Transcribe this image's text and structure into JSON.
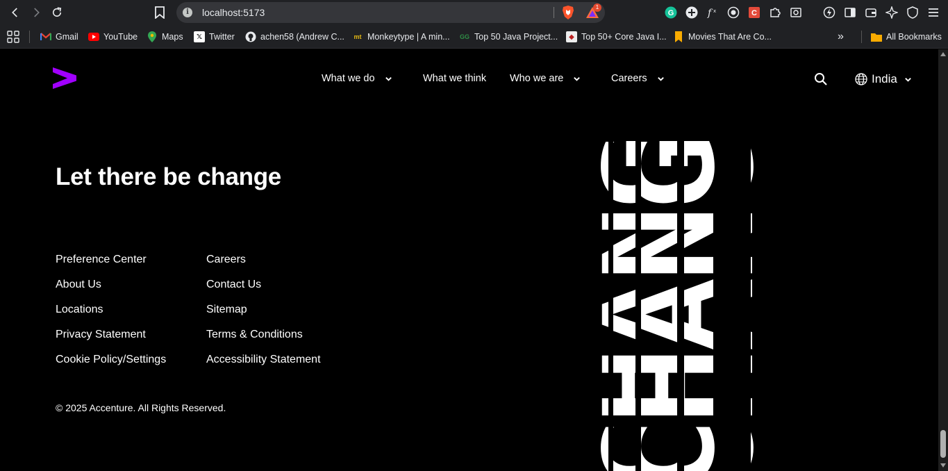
{
  "browser": {
    "url": "localhost:5173",
    "rewards_badge": "1",
    "bookmarks": [
      {
        "label": "Gmail",
        "icon": "gmail-icon"
      },
      {
        "label": "YouTube",
        "icon": "youtube-icon"
      },
      {
        "label": "Maps",
        "icon": "maps-icon"
      },
      {
        "label": "Twitter",
        "icon": "x-icon"
      },
      {
        "label": "achen58 (Andrew C...",
        "icon": "github-icon"
      },
      {
        "label": "Monkeytype | A min...",
        "icon": "monkeytype-icon"
      },
      {
        "label": "Top 50 Java Project...",
        "icon": "geeksforgeeks-icon"
      },
      {
        "label": "Top 50+ Core Java I...",
        "icon": "site-icon"
      },
      {
        "label": "Movies That Are Co...",
        "icon": "bookmark-icon"
      }
    ],
    "more_label": "»",
    "all_bookmarks": "All Bookmarks"
  },
  "site": {
    "brand_color": "#a100ff",
    "nav": [
      {
        "label": "What we do",
        "has_dropdown": true
      },
      {
        "label": "What we think",
        "has_dropdown": false
      },
      {
        "label": "Who we are",
        "has_dropdown": true
      },
      {
        "label": "Careers",
        "has_dropdown": true
      }
    ],
    "language": "India"
  },
  "footer": {
    "headline": "Let there be change",
    "links_col1": [
      "Preference Center",
      "About Us",
      "Locations",
      "Privacy Statement",
      "Cookie Policy/Settings"
    ],
    "links_col2": [
      "Careers",
      "Contact Us",
      "Sitemap",
      "Terms & Conditions",
      "Accessibility Statement"
    ],
    "copyright": "© 2025 Accenture. All Rights Reserved."
  }
}
